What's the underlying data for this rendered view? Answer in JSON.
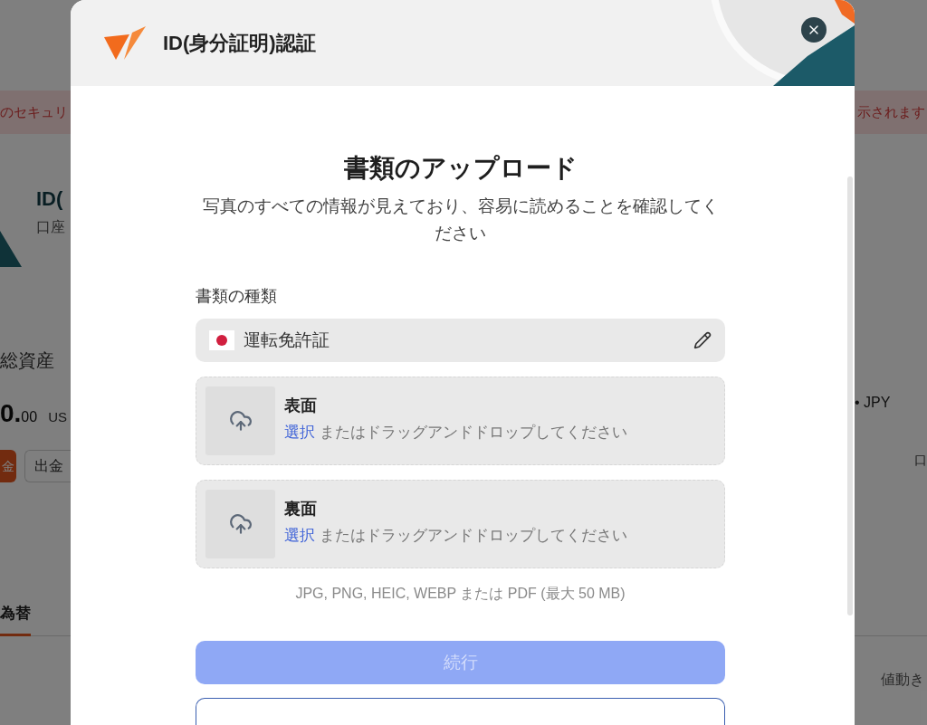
{
  "background_page": {
    "banner": {
      "left_text": "のセキュリ",
      "right_text": "示されます"
    },
    "account": {
      "title": "ID(",
      "subtitle": "口座"
    },
    "balance": {
      "label": "総資産",
      "amount": "0.",
      "decimals": "00",
      "currency": "US"
    },
    "buttons": [
      {
        "label": "金",
        "kind": "primary"
      },
      {
        "label": "出金",
        "kind": "outline"
      }
    ],
    "tabs": [
      {
        "label": "為替",
        "selected": true
      }
    ],
    "currency_pair": "• JPY",
    "column_heading": "口",
    "table_heading": "値動き"
  },
  "dialog": {
    "title": "ID(身分証明)認証",
    "heading": "書類のアップロード",
    "description": "写真のすべての情報が見えており、容易に読めることを確認してください",
    "document_type": {
      "label": "書類の種類",
      "value": "運転免許証"
    },
    "uploads": [
      {
        "title": "表面",
        "link": "選択",
        "instruction": "またはドラッグアンドドロップしてください"
      },
      {
        "title": "裏面",
        "link": "選択",
        "instruction": "またはドラッグアンドドロップしてください"
      }
    ],
    "formats_hint": "JPG, PNG, HEIC, WEBP または PDF (最大 50 MB)",
    "continue_button": {
      "label": "続行",
      "disabled": true
    }
  }
}
